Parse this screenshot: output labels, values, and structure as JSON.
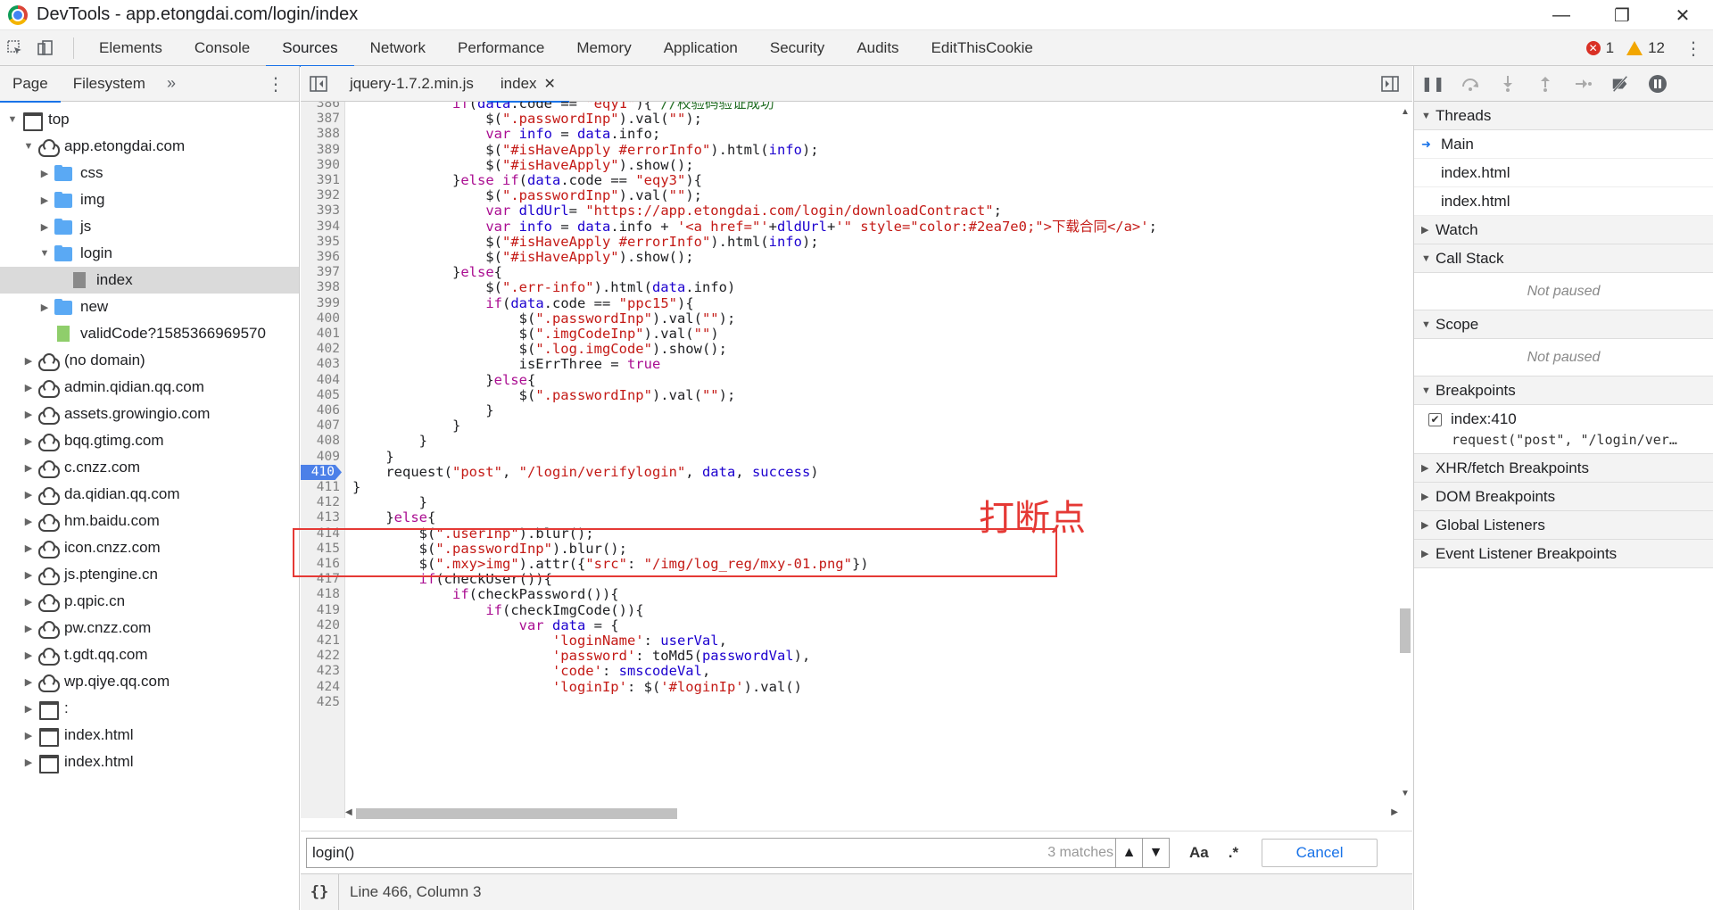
{
  "window": {
    "title": "DevTools - app.etongdai.com/login/index",
    "min": "—",
    "restore": "❐",
    "close": "✕"
  },
  "tabs": [
    "Elements",
    "Console",
    "Sources",
    "Network",
    "Performance",
    "Memory",
    "Application",
    "Security",
    "Audits",
    "EditThisCookie"
  ],
  "active_tab": "Sources",
  "status": {
    "errors": "1",
    "warnings": "12"
  },
  "navigator": {
    "tabs": [
      "Page",
      "Filesystem"
    ],
    "more": "»",
    "tree": [
      {
        "label": "top",
        "icon": "frame",
        "indent": 0,
        "arrow": "▼"
      },
      {
        "label": "app.etongdai.com",
        "icon": "cloud",
        "indent": 1,
        "arrow": "▼"
      },
      {
        "label": "css",
        "icon": "folder",
        "indent": 2,
        "arrow": "▶"
      },
      {
        "label": "img",
        "icon": "folder",
        "indent": 2,
        "arrow": "▶"
      },
      {
        "label": "js",
        "icon": "folder",
        "indent": 2,
        "arrow": "▶"
      },
      {
        "label": "login",
        "icon": "folder",
        "indent": 2,
        "arrow": "▼"
      },
      {
        "label": "index",
        "icon": "file-grey",
        "indent": 3,
        "arrow": "",
        "selected": true
      },
      {
        "label": "new",
        "icon": "folder",
        "indent": 2,
        "arrow": "▶"
      },
      {
        "label": "validCode?1585366969570",
        "icon": "file-green",
        "indent": 2,
        "arrow": ""
      },
      {
        "label": "(no domain)",
        "icon": "cloud",
        "indent": 1,
        "arrow": "▶"
      },
      {
        "label": "admin.qidian.qq.com",
        "icon": "cloud",
        "indent": 1,
        "arrow": "▶"
      },
      {
        "label": "assets.growingio.com",
        "icon": "cloud",
        "indent": 1,
        "arrow": "▶"
      },
      {
        "label": "bqq.gtimg.com",
        "icon": "cloud",
        "indent": 1,
        "arrow": "▶"
      },
      {
        "label": "c.cnzz.com",
        "icon": "cloud",
        "indent": 1,
        "arrow": "▶"
      },
      {
        "label": "da.qidian.qq.com",
        "icon": "cloud",
        "indent": 1,
        "arrow": "▶"
      },
      {
        "label": "hm.baidu.com",
        "icon": "cloud",
        "indent": 1,
        "arrow": "▶"
      },
      {
        "label": "icon.cnzz.com",
        "icon": "cloud",
        "indent": 1,
        "arrow": "▶"
      },
      {
        "label": "js.ptengine.cn",
        "icon": "cloud",
        "indent": 1,
        "arrow": "▶"
      },
      {
        "label": "p.qpic.cn",
        "icon": "cloud",
        "indent": 1,
        "arrow": "▶"
      },
      {
        "label": "pw.cnzz.com",
        "icon": "cloud",
        "indent": 1,
        "arrow": "▶"
      },
      {
        "label": "t.gdt.qq.com",
        "icon": "cloud",
        "indent": 1,
        "arrow": "▶"
      },
      {
        "label": "wp.qiye.qq.com",
        "icon": "cloud",
        "indent": 1,
        "arrow": "▶"
      },
      {
        "label": ":",
        "icon": "frame",
        "indent": 1,
        "arrow": "▶"
      },
      {
        "label": "index.html",
        "icon": "frame",
        "indent": 1,
        "arrow": "▶"
      },
      {
        "label": "index.html",
        "icon": "frame",
        "indent": 1,
        "arrow": "▶"
      }
    ]
  },
  "editor": {
    "files": [
      {
        "name": "jquery-1.7.2.min.js",
        "active": false
      },
      {
        "name": "index",
        "active": true,
        "close": "✕"
      }
    ],
    "breakpoint_line": "410",
    "lines": [
      {
        "n": "386",
        "html": "            <span class='kw'>if</span>(<span class='vr'>data</span>.code == <span class='str'>\"eqy1\"</span>){ <span class='cm'>//校验码验证成功</span>"
      },
      {
        "n": "387",
        "html": "                $(<span class='str'>\".passwordInp\"</span>).val(<span class='str'>\"\"</span>);"
      },
      {
        "n": "388",
        "html": "                <span class='kw'>var</span> <span class='vr'>info</span> = <span class='vr'>data</span>.info;"
      },
      {
        "n": "389",
        "html": "                $(<span class='str'>\"#isHaveApply #errorInfo\"</span>).html(<span class='vr'>info</span>);"
      },
      {
        "n": "390",
        "html": "                $(<span class='str'>\"#isHaveApply\"</span>).show();"
      },
      {
        "n": "391",
        "html": "            }<span class='kw'>else if</span>(<span class='vr'>data</span>.code == <span class='str'>\"eqy3\"</span>){"
      },
      {
        "n": "392",
        "html": "                $(<span class='str'>\".passwordInp\"</span>).val(<span class='str'>\"\"</span>);"
      },
      {
        "n": "393",
        "html": "                <span class='kw'>var</span> <span class='vr'>dldUrl</span>= <span class='str'>\"https://app.etongdai.com/login/downloadContract\"</span>;"
      },
      {
        "n": "394",
        "html": "                <span class='kw'>var</span> <span class='vr'>info</span> = <span class='vr'>data</span>.info + <span class='str'>'&lt;a href=\"'</span>+<span class='vr'>dldUrl</span>+<span class='str'>'\" style=\"color:#2ea7e0;\"&gt;下载合同&lt;/a&gt;'</span>;"
      },
      {
        "n": "395",
        "html": "                $(<span class='str'>\"#isHaveApply #errorInfo\"</span>).html(<span class='vr'>info</span>);"
      },
      {
        "n": "396",
        "html": "                $(<span class='str'>\"#isHaveApply\"</span>).show();"
      },
      {
        "n": "397",
        "html": "            }<span class='kw'>else</span>{"
      },
      {
        "n": "398",
        "html": "                $(<span class='str'>\".err-info\"</span>).html(<span class='vr'>data</span>.info)"
      },
      {
        "n": "399",
        "html": "                <span class='kw'>if</span>(<span class='vr'>data</span>.code == <span class='str'>\"ppc15\"</span>){"
      },
      {
        "n": "400",
        "html": "                    $(<span class='str'>\".passwordInp\"</span>).val(<span class='str'>\"\"</span>);"
      },
      {
        "n": "401",
        "html": "                    $(<span class='str'>\".imgCodeInp\"</span>).val(<span class='str'>\"\"</span>)"
      },
      {
        "n": "402",
        "html": "                    $(<span class='str'>\".log.imgCode\"</span>).show();"
      },
      {
        "n": "403",
        "html": "                    isErrThree = <span class='kw'>true</span>"
      },
      {
        "n": "404",
        "html": "                }<span class='kw'>else</span>{"
      },
      {
        "n": "405",
        "html": "                    $(<span class='str'>\".passwordInp\"</span>).val(<span class='str'>\"\"</span>);"
      },
      {
        "n": "406",
        "html": "                }"
      },
      {
        "n": "407",
        "html": "            }"
      },
      {
        "n": "408",
        "html": "        }"
      },
      {
        "n": "409",
        "html": "    }"
      },
      {
        "n": "410",
        "html": "    request(<span class='str'>\"post\"</span>, <span class='str'>\"/login/verifylogin\"</span>, <span class='vr'>data</span>, <span class='vr'>success</span>)"
      },
      {
        "n": "411",
        "html": "}"
      },
      {
        "n": "412",
        "html": "        }"
      },
      {
        "n": "413",
        "html": "    }<span class='kw'>else</span>{"
      },
      {
        "n": "414",
        "html": "        $(<span class='str'>\".userInp\"</span>).blur();"
      },
      {
        "n": "415",
        "html": "        $(<span class='str'>\".passwordInp\"</span>).blur();"
      },
      {
        "n": "416",
        "html": "        $(<span class='str'>\".mxy&gt;img\"</span>).attr({<span class='str'>\"src\"</span>: <span class='str'>\"/img/log_reg/mxy-01.png\"</span>})"
      },
      {
        "n": "417",
        "html": "        <span class='kw'>if</span>(checkUser()){"
      },
      {
        "n": "418",
        "html": "            <span class='kw'>if</span>(checkPassword()){"
      },
      {
        "n": "419",
        "html": "                <span class='kw'>if</span>(checkImgCode()){"
      },
      {
        "n": "420",
        "html": "                    <span class='kw'>var</span> <span class='vr'>data</span> = {"
      },
      {
        "n": "421",
        "html": "                        <span class='str'>'loginName'</span>: <span class='vr'>userVal</span>,"
      },
      {
        "n": "422",
        "html": "                        <span class='str'>'password'</span>: toMd5(<span class='vr'>passwordVal</span>),"
      },
      {
        "n": "423",
        "html": "                        <span class='str'>'code'</span>: <span class='vr'>smscodeVal</span>,"
      },
      {
        "n": "424",
        "html": "                        <span class='str'>'loginIp'</span>: $(<span class='str'>'#loginIp'</span>).val()"
      },
      {
        "n": "425",
        "html": ""
      }
    ]
  },
  "annotation": "打断点",
  "search": {
    "value": "login()",
    "matches": "3 matches",
    "prev": "▲",
    "next": "▼",
    "case": "Aa",
    "regex": ".*",
    "cancel": "Cancel"
  },
  "statusbar": {
    "pretty": "{}",
    "position": "Line 466, Column 3"
  },
  "debugger": {
    "threads_label": "Threads",
    "threads": [
      {
        "label": "Main",
        "current": true
      },
      {
        "label": "index.html",
        "current": false
      },
      {
        "label": "index.html",
        "current": false
      }
    ],
    "watch_label": "Watch",
    "callstack_label": "Call Stack",
    "callstack_empty": "Not paused",
    "scope_label": "Scope",
    "scope_empty": "Not paused",
    "breakpoints_label": "Breakpoints",
    "breakpoints": [
      {
        "location": "index:410",
        "code": "request(\"post\", \"/login/ver…",
        "checked": true
      }
    ],
    "other_sections": [
      "XHR/fetch Breakpoints",
      "DOM Breakpoints",
      "Global Listeners",
      "Event Listener Breakpoints"
    ]
  }
}
